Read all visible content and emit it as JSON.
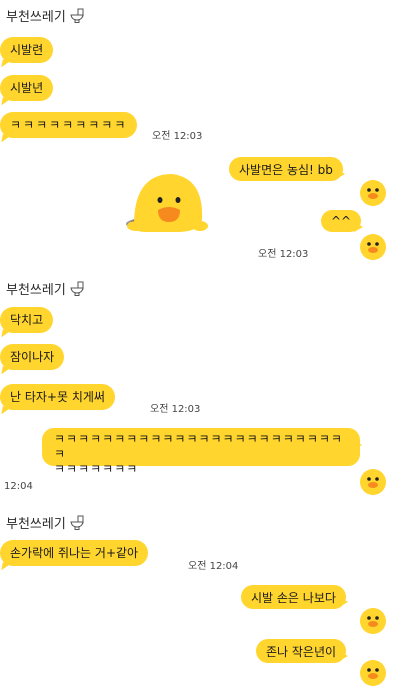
{
  "chat": {
    "sender_name": "부천쓰레기",
    "messages": [
      {
        "text": "시발련"
      },
      {
        "text": "시발년"
      },
      {
        "text": "ㅋㅋㅋㅋㅋㅋㅋㅋㅋ",
        "time": "오전 12:03"
      },
      {
        "text": "사발면은 농심! bb"
      },
      {
        "text": "^^",
        "time": "오전 12:03"
      },
      {
        "text": "닥치고"
      },
      {
        "text": "잠이나자"
      },
      {
        "text": "난 타자+못 치게써",
        "time": "오전 12:03"
      },
      {
        "text": "ㅋㅋㅋㅋㅋㅋㅋㅋㅋㅋㅋㅋㅋㅋㅋㅋㅋㅋㅋㅋㅋㅋㅋㅋㅋ",
        "text2": "ㅋㅋㅋㅋㅋㅋㅋ",
        "time": "12:04"
      },
      {
        "text": "손가락에 쥐나는 거+같아",
        "time": "오전 12:04"
      },
      {
        "text": "시발 손은 나보다"
      },
      {
        "text": "존나 작은년이"
      }
    ]
  },
  "colors": {
    "bubble": "#ffd52e",
    "background": "#ffffff"
  }
}
